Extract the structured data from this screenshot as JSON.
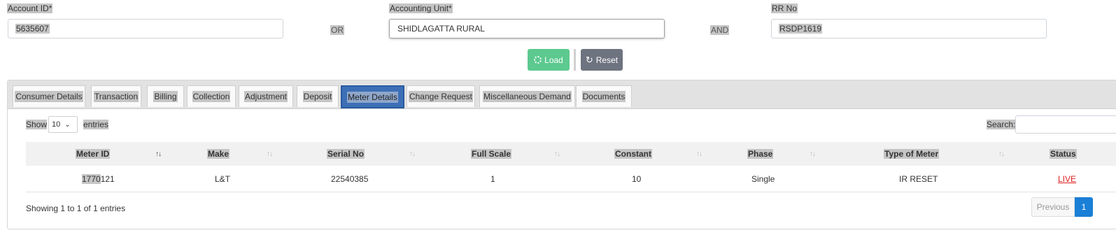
{
  "form": {
    "account_id": {
      "label": "Account ID*",
      "value": "5635607"
    },
    "or_text": "OR",
    "accounting_unit": {
      "label": "Accounting Unit*",
      "value": "SHIDLAGATTA RURAL"
    },
    "and_text": "AND",
    "rr_no": {
      "label": "RR No",
      "value": "RSDP1619"
    },
    "load_label": "Load",
    "reset_label": "Reset"
  },
  "tabs": [
    {
      "label": "Consumer Details"
    },
    {
      "label": "Transaction"
    },
    {
      "label": "Billing"
    },
    {
      "label": "Collection"
    },
    {
      "label": "Adjustment"
    },
    {
      "label": "Deposit"
    },
    {
      "label": "Meter Details",
      "active": true
    },
    {
      "label": "Change Request"
    },
    {
      "label": "Miscellaneous Demand"
    },
    {
      "label": "Documents"
    }
  ],
  "table_controls": {
    "show_label": "Show",
    "entries_value": "10",
    "entries_label": "entries",
    "search_label": "Search:"
  },
  "table": {
    "columns": [
      "Meter ID",
      "Make",
      "Serial No",
      "Full Scale",
      "Constant",
      "Phase",
      "Type of Meter",
      "Status"
    ],
    "rows": [
      {
        "meter_id_highlight": "1770",
        "meter_id_rest": "121",
        "make": "L&T",
        "serial_no": "22540385",
        "full_scale": "1",
        "constant": "10",
        "phase": "Single",
        "type_of_meter": "IR RESET",
        "status": "LIVE"
      }
    ]
  },
  "footer": {
    "info": "Showing 1 to 1 of 1 entries",
    "prev_label": "Previous",
    "page": "1"
  },
  "colors": {
    "load_button": "#5cc98f",
    "reset_button": "#6e7380",
    "active_tab": "#3c6fb6",
    "status_live": "#e02020",
    "page_active": "#1a7fd6"
  }
}
